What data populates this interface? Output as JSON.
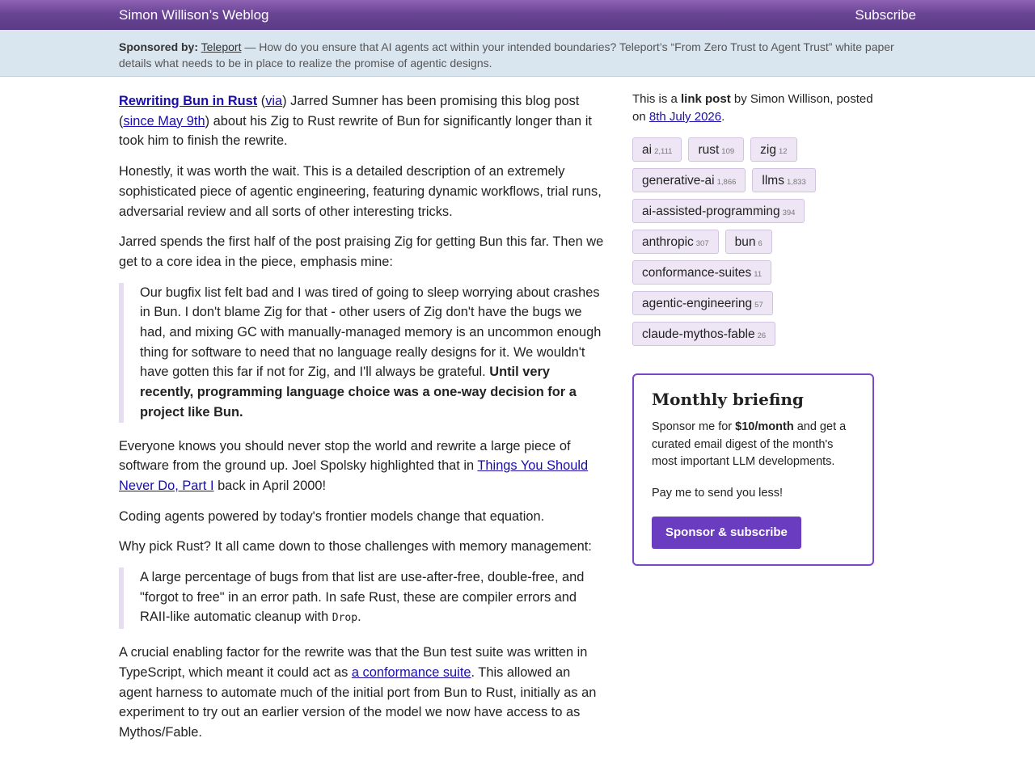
{
  "header": {
    "site_title": "Simon Willison’s Weblog",
    "subscribe": "Subscribe"
  },
  "sponsor": {
    "label": "Sponsored by:",
    "sponsor_name": "Teleport",
    "message": " — How do you ensure that AI agents act within your intended boundaries? Teleport’s “From Zero Trust to Agent Trust” white paper details what needs to be in place to realize the promise of agentic designs."
  },
  "post": {
    "p1": {
      "title": "Rewriting Bun in Rust",
      "t1": " (",
      "via": "via",
      "t2": ") Jarred Sumner has been promising this blog post (",
      "since_link": "since May 9th",
      "t3": ") about his Zig to Rust rewrite of Bun for significantly longer than it took him to finish the rewrite."
    },
    "p2": "Honestly, it was worth the wait. This is a detailed description of an extremely sophisticated piece of agentic engineering, featuring dynamic workflows, trial runs, adversarial review and all sorts of other interesting tricks.",
    "p3": "Jarred spends the first half of the post praising Zig for getting Bun this far. Then we get to a core idea in the piece, emphasis mine:",
    "quote1": {
      "text": "Our bugfix list felt bad and I was tired of going to sleep worrying about crashes in Bun. I don't blame Zig for that - other users of Zig don't have the bugs we had, and mixing GC with manually-managed memory is an uncommon enough thing for software to need that no language really designs for it. We wouldn't have gotten this far if not for Zig, and I'll always be grateful. ",
      "emphasis": "Until very recently, programming language choice was a one-way decision for a project like Bun."
    },
    "p4": {
      "t1": "Everyone knows you should never stop the world and rewrite a large piece of software from the ground up. Joel Spolsky highlighted that in ",
      "link": "Things You Should Never Do, Part I",
      "t2": " back in April 2000!"
    },
    "p5": "Coding agents powered by today's frontier models change that equation.",
    "p6": "Why pick Rust? It all came down to those challenges with memory management:",
    "quote2": {
      "text": "A large percentage of bugs from that list are use-after-free, double-free, and \"forgot to free\" in an error path. In safe Rust, these are compiler errors and RAII-like automatic cleanup with ",
      "code": "Drop",
      "end": "."
    },
    "p7": {
      "t1": "A crucial enabling factor for the rewrite was that the Bun test suite was written in TypeScript, which meant it could act as ",
      "link": "a conformance suite",
      "t2": ". This allowed an agent harness to automate much of the initial port from Bun to Rust, initially as an experiment to try out an earlier version of the model we now have access to as Mythos/Fable."
    }
  },
  "sidebar": {
    "meta": {
      "t1": "This is a ",
      "bold": "link post",
      "t2": " by Simon Willison, posted on ",
      "date": "8th July 2026",
      "t3": "."
    },
    "tags": [
      {
        "name": "ai",
        "count": "2,111"
      },
      {
        "name": "rust",
        "count": "109"
      },
      {
        "name": "zig",
        "count": "12"
      },
      {
        "name": "generative-ai",
        "count": "1,866"
      },
      {
        "name": "llms",
        "count": "1,833"
      },
      {
        "name": "ai-assisted-programming",
        "count": "394"
      },
      {
        "name": "anthropic",
        "count": "307"
      },
      {
        "name": "bun",
        "count": "6"
      },
      {
        "name": "conformance-suites",
        "count": "11"
      },
      {
        "name": "agentic-engineering",
        "count": "57"
      },
      {
        "name": "claude-mythos-fable",
        "count": "26"
      }
    ],
    "briefing": {
      "title": "Monthly briefing",
      "t1": "Sponsor me for ",
      "price": "$10/month",
      "t2": " and get a curated email digest of the month's most important LLM developments.",
      "p2": "Pay me to send you less!",
      "button": "Sponsor & subscribe"
    }
  },
  "colors": {
    "header_purple": "#6a4595",
    "sponsor_bar": "#d9e5ef",
    "tag_bg": "#eee6f4",
    "accent_purple": "#6a3cc0",
    "link": "#1a0dab"
  }
}
